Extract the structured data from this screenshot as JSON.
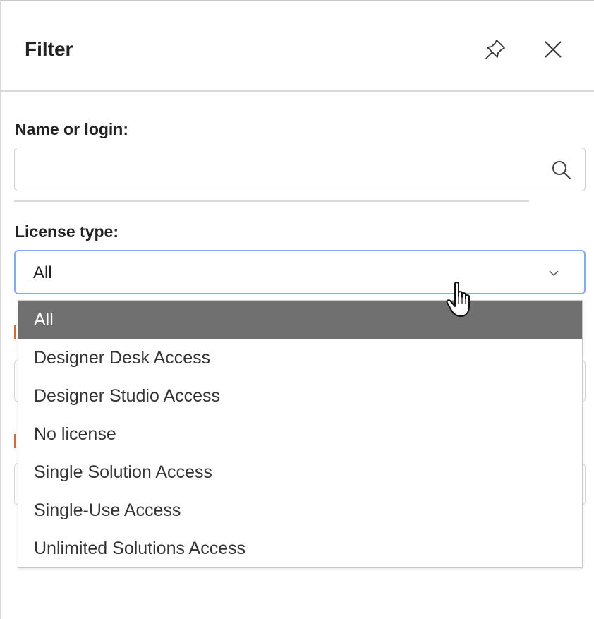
{
  "header": {
    "title": "Filter",
    "pin_icon": "pin-icon",
    "close_icon": "close-icon"
  },
  "name_filter": {
    "label": "Name or login:",
    "value": "",
    "placeholder": "",
    "icon": "search-icon"
  },
  "license_filter": {
    "label": "License type:",
    "selected": "All",
    "icon": "chevron-down-icon",
    "focus_color": "#88aaf0",
    "options": [
      "All",
      "Designer Desk Access",
      "Designer Studio Access",
      "No license",
      "Single Solution Access",
      "Single-Use Access",
      "Unlimited Solutions Access"
    ]
  },
  "colors": {
    "selected_option_bg": "#707070",
    "selected_option_text": "#ffffff",
    "label_accent": "#c8703a"
  }
}
